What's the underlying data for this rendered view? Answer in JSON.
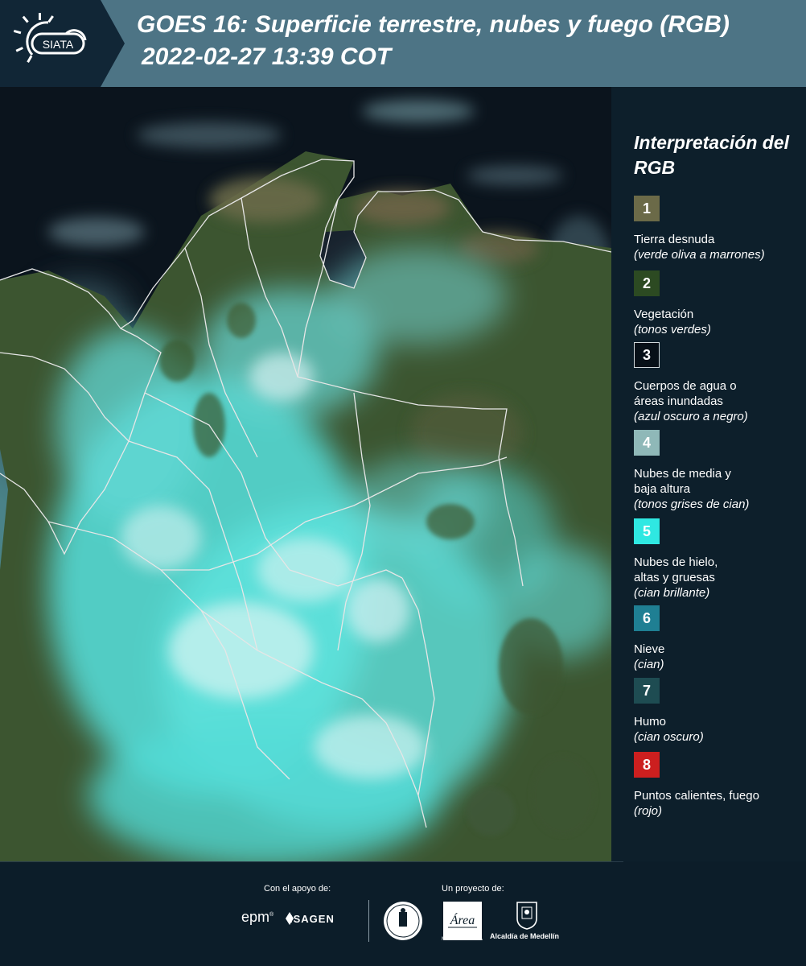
{
  "header": {
    "logo_text": "SIATA",
    "title_line1": "GOES 16: Superficie terrestre, nubes y fuego (RGB)",
    "title_line2": "2022-02-27 13:39 COT"
  },
  "map": {
    "region": "Colombia y norte de Suramérica",
    "colors": {
      "ocean": "#0b141d",
      "vegetation": "#3c5530",
      "bare_land": "#6b6a48",
      "cloud_cyan": "#56e2de",
      "cloud_white": "#d2f3f1",
      "borders": "#e6e6e6"
    }
  },
  "legend": {
    "title": "Interpretación del RGB",
    "items": [
      {
        "number": "1",
        "label": "Tierra desnuda",
        "desc": "(verde oliva a marrones)",
        "color": "#6b6a48"
      },
      {
        "number": "2",
        "label": "Vegetación",
        "desc": "(tonos verdes)",
        "color": "#2c4a22"
      },
      {
        "number": "3",
        "label": "Cuerpos de agua o\náreas inundadas",
        "desc": "(azul oscuro a negro)",
        "color": "#071018"
      },
      {
        "number": "4",
        "label": "Nubes de media y\nbaja altura",
        "desc": "(tonos grises de cian)",
        "color": "#8fb8b8"
      },
      {
        "number": "5",
        "label": "Nubes de hielo,\naltas y gruesas",
        "desc": "(cian brillante)",
        "color": "#2fe8e2"
      },
      {
        "number": "6",
        "label": "Nieve",
        "desc": "(cian)",
        "color": "#1f7f93"
      },
      {
        "number": "7",
        "label": "Humo",
        "desc": "(cian oscuro)",
        "color": "#1e4c52"
      },
      {
        "number": "8",
        "label": "Puntos calientes, fuego",
        "desc": "(rojo)",
        "color": "#cc1f1f"
      }
    ]
  },
  "footer": {
    "support_label": "Con el apoyo de:",
    "project_label": "Un proyecto de:",
    "sponsor_epm": "epm",
    "sponsor_epm_mark": "®",
    "sponsor_isagen": "ISAGEN",
    "sponsor_alcaldia": "Alcaldía de Medellín",
    "sponsor_area": "Área",
    "sponsor_area_caption": "METROPOLITANA"
  }
}
